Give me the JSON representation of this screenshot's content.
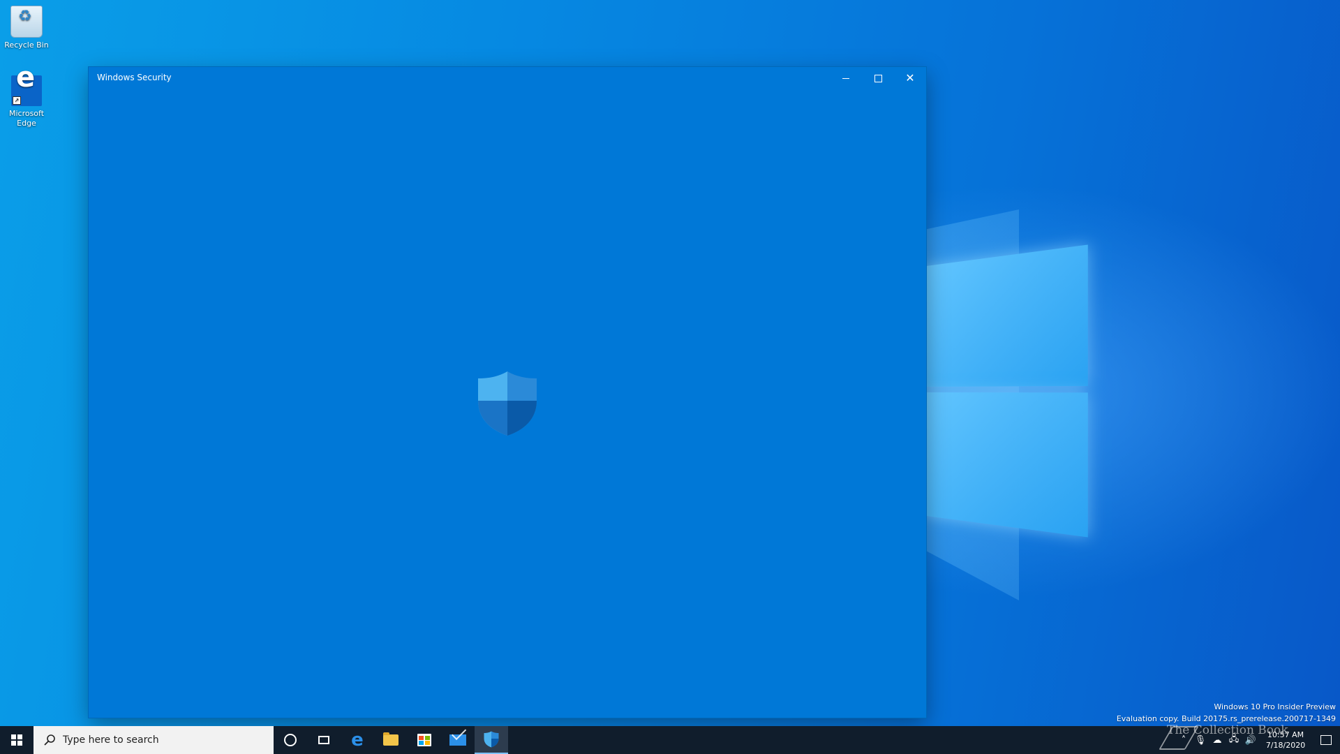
{
  "desktop": {
    "icons": [
      {
        "label": "Recycle Bin",
        "icon": "recycle-bin-icon"
      },
      {
        "label": "Microsoft Edge",
        "icon": "edge-icon"
      }
    ],
    "watermark_line1": "Windows 10 Pro Insider Preview",
    "watermark_line2": "Evaluation copy. Build 20175.rs_prerelease.200717-1349",
    "overlay_logo_text": "The Collection Book"
  },
  "window": {
    "title": "Windows Security",
    "center_icon": "windows-security-shield-icon",
    "colors": {
      "background": "#0078d7",
      "shield_light": "#4db3f0",
      "shield_dark": "#0a5aa8"
    }
  },
  "taskbar": {
    "search_placeholder": "Type here to search",
    "apps": [
      "cortana-icon",
      "task-view-icon",
      "edge-icon",
      "file-explorer-icon",
      "store-icon",
      "mail-icon",
      "windows-security-icon"
    ],
    "active_app": "windows-security-icon",
    "clock_time": "10:57 AM",
    "clock_date": "7/18/2020"
  }
}
